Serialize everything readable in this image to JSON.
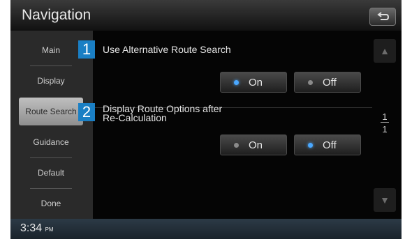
{
  "title": "Navigation",
  "sidebar": {
    "items": [
      {
        "label": "Main"
      },
      {
        "label": "Display"
      },
      {
        "label": "Route Search"
      },
      {
        "label": "Guidance"
      },
      {
        "label": "Default"
      },
      {
        "label": "Done"
      }
    ]
  },
  "settings": [
    {
      "marker": "1",
      "label": "Use Alternative Route Search",
      "options": [
        {
          "label": "On",
          "selected": true
        },
        {
          "label": "Off",
          "selected": false
        }
      ]
    },
    {
      "marker": "2",
      "label_line1": "Display Route Options after",
      "label_line2": "Re-Calculation",
      "options": [
        {
          "label": "On",
          "selected": false
        },
        {
          "label": "Off",
          "selected": true
        }
      ]
    }
  ],
  "pager": {
    "current": "1",
    "total": "1"
  },
  "status": {
    "time": "3:34",
    "ampm": "PM"
  },
  "colors": {
    "accent": "#1a7fc4",
    "selected_dot": "#4aa8ff"
  },
  "icons": {
    "back": "back-arrow-icon",
    "up": "scroll-up-icon",
    "down": "scroll-down-icon"
  }
}
